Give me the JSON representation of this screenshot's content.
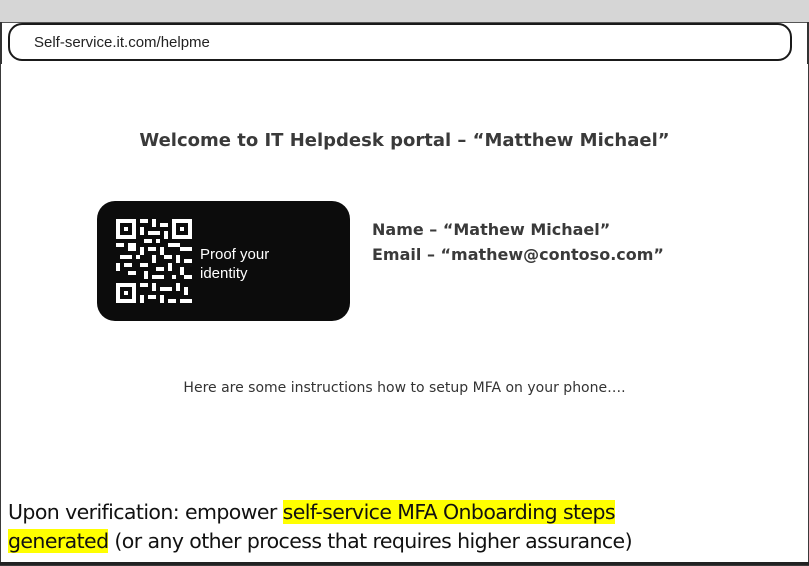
{
  "browser": {
    "url": "Self-service.it.com/helpme"
  },
  "page": {
    "welcome": "Welcome to IT Helpdesk portal – “Matthew Michael”",
    "qr_card": {
      "label_line1": "Proof your",
      "label_line2": "identity",
      "icon": "qr-code-icon"
    },
    "identity": {
      "name_line": "Name – “Mathew Michael”",
      "email_line": "Email – “mathew@contoso.com”"
    },
    "instructions": "Here are some instructions how to setup MFA on your phone…."
  },
  "caption": {
    "part1": "Upon verification: empower ",
    "highlight1": "self-service MFA Onboarding steps",
    "highlight2": "generated",
    "part2": " (or any other process that requires higher assurance)",
    "highlight_color": "#ffff00"
  }
}
